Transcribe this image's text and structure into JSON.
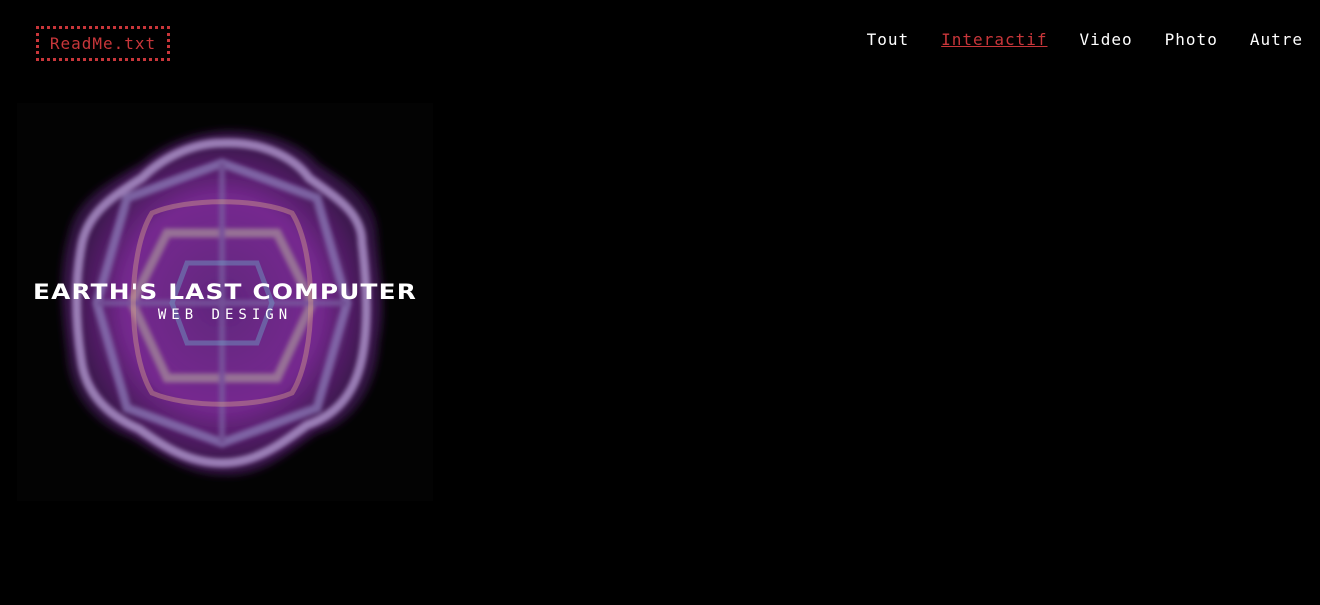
{
  "header": {
    "logo_label": "ReadMe.txt",
    "accent_color": "#c8363a"
  },
  "nav": {
    "items": [
      {
        "label": "Tout",
        "active": false
      },
      {
        "label": "Interactif",
        "active": true
      },
      {
        "label": "Video",
        "active": false
      },
      {
        "label": "Photo",
        "active": false
      },
      {
        "label": "Autre",
        "active": false
      }
    ]
  },
  "projects": [
    {
      "title": "EARTH'S LAST COMPUTER",
      "category": "WEB DESIGN"
    }
  ]
}
